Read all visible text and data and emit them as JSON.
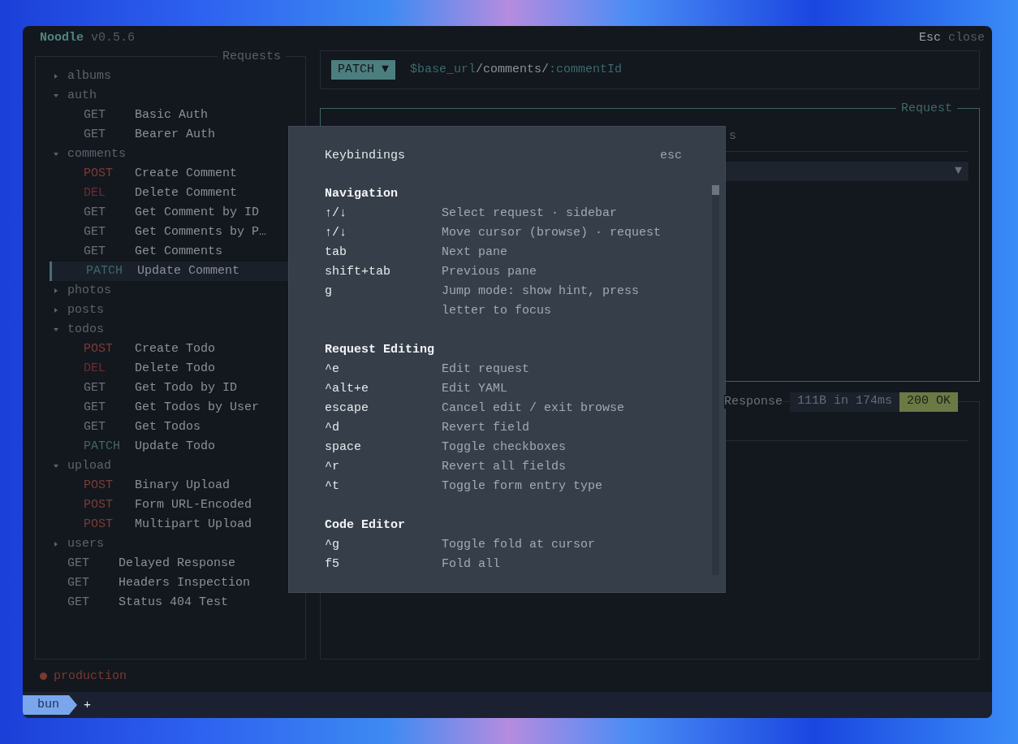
{
  "window": {
    "app_name": "Noodle",
    "version": "v0.5.6",
    "close_key": "Esc",
    "close_label": "close"
  },
  "sidebar": {
    "title": "Requests",
    "items": [
      {
        "kind": "folder",
        "label": "albums",
        "expanded": false
      },
      {
        "kind": "folder",
        "label": "auth",
        "expanded": true,
        "children": [
          {
            "kind": "request",
            "method": "GET",
            "color": "#6a7079",
            "label": "Basic Auth",
            "selected": false
          },
          {
            "kind": "request",
            "method": "GET",
            "color": "#6a7079",
            "label": "Bearer Auth",
            "selected": false
          }
        ]
      },
      {
        "kind": "folder",
        "label": "comments",
        "expanded": true,
        "children": [
          {
            "kind": "request",
            "method": "POST",
            "color": "#7c3b36",
            "label": "Create Comment",
            "selected": false
          },
          {
            "kind": "request",
            "method": "DEL",
            "color": "#6e2c31",
            "label": "Delete Comment",
            "selected": false
          },
          {
            "kind": "request",
            "method": "GET",
            "color": "#6a7079",
            "label": "Get Comment by ID",
            "selected": false
          },
          {
            "kind": "request",
            "method": "GET",
            "color": "#6a7079",
            "label": "Get Comments by P…",
            "selected": false
          },
          {
            "kind": "request",
            "method": "GET",
            "color": "#6a7079",
            "label": "Get Comments",
            "selected": false
          },
          {
            "kind": "request",
            "method": "PATCH",
            "color": "#3f676b",
            "label": "Update Comment",
            "selected": true
          }
        ]
      },
      {
        "kind": "folder",
        "label": "photos",
        "expanded": false
      },
      {
        "kind": "folder",
        "label": "posts",
        "expanded": false
      },
      {
        "kind": "folder",
        "label": "todos",
        "expanded": true,
        "children": [
          {
            "kind": "request",
            "method": "POST",
            "color": "#7c3b36",
            "label": "Create Todo",
            "selected": false
          },
          {
            "kind": "request",
            "method": "DEL",
            "color": "#6e2c31",
            "label": "Delete Todo",
            "selected": false
          },
          {
            "kind": "request",
            "method": "GET",
            "color": "#6a7079",
            "label": "Get Todo by ID",
            "selected": false
          },
          {
            "kind": "request",
            "method": "GET",
            "color": "#6a7079",
            "label": "Get Todos by User",
            "selected": false
          },
          {
            "kind": "request",
            "method": "GET",
            "color": "#6a7079",
            "label": "Get Todos",
            "selected": false
          },
          {
            "kind": "request",
            "method": "PATCH",
            "color": "#3f676b",
            "label": "Update Todo",
            "selected": false
          }
        ]
      },
      {
        "kind": "folder",
        "label": "upload",
        "expanded": true,
        "children": [
          {
            "kind": "request",
            "method": "POST",
            "color": "#7c3b36",
            "label": "Binary Upload",
            "selected": false
          },
          {
            "kind": "request",
            "method": "POST",
            "color": "#7c3b36",
            "label": "Form URL-Encoded",
            "selected": false
          },
          {
            "kind": "request",
            "method": "POST",
            "color": "#7c3b36",
            "label": "Multipart Upload",
            "selected": false
          }
        ]
      },
      {
        "kind": "folder",
        "label": "users",
        "expanded": false
      },
      {
        "kind": "request",
        "method": "GET",
        "color": "#6a7079",
        "label": "Delayed Response",
        "selected": false
      },
      {
        "kind": "request",
        "method": "GET",
        "color": "#6a7079",
        "label": "Headers Inspection",
        "selected": false
      },
      {
        "kind": "request",
        "method": "GET",
        "color": "#6a7079",
        "label": "Status 404 Test",
        "selected": false
      }
    ]
  },
  "url_bar": {
    "method": "PATCH ▼",
    "url": [
      {
        "kind": "variable",
        "text": "$base_url"
      },
      {
        "kind": "path",
        "text": "/comments/"
      },
      {
        "kind": "param",
        "text": ":commentId"
      }
    ]
  },
  "request_pane": {
    "title": "Request",
    "tab_fragment": "s",
    "dropdown_caret": "▼"
  },
  "response_pane": {
    "title": "Response",
    "size_time": "111B in 174ms",
    "status": "200 OK"
  },
  "environment": {
    "name": "production",
    "color": "#7a3a31"
  },
  "session_tabs": [
    {
      "label": "bun",
      "selected": true
    },
    {
      "label": "+",
      "selected": false
    }
  ],
  "keybindings": {
    "title": "Keybindings",
    "close_hint": "esc",
    "sections": [
      {
        "heading": "Navigation",
        "rows": [
          {
            "key": "↑/↓",
            "action": "Select request · sidebar"
          },
          {
            "key": "↑/↓",
            "action": "Move cursor (browse) · request"
          },
          {
            "key": "tab",
            "action": "Next pane"
          },
          {
            "key": "shift+tab",
            "action": "Previous pane"
          },
          {
            "key": "g",
            "action": "Jump mode: show hint, press letter to focus"
          }
        ]
      },
      {
        "heading": "Request Editing",
        "rows": [
          {
            "key": "^e",
            "action": "Edit request"
          },
          {
            "key": "^alt+e",
            "action": "Edit YAML"
          },
          {
            "key": "escape",
            "action": "Cancel edit / exit browse"
          },
          {
            "key": "^d",
            "action": "Revert field"
          },
          {
            "key": "space",
            "action": "Toggle checkboxes"
          },
          {
            "key": "^r",
            "action": "Revert all fields"
          },
          {
            "key": "^t",
            "action": "Toggle form entry type"
          }
        ]
      },
      {
        "heading": "Code Editor",
        "rows": [
          {
            "key": "^g",
            "action": "Toggle fold at cursor"
          },
          {
            "key": "f5",
            "action": "Fold all"
          }
        ]
      }
    ]
  }
}
